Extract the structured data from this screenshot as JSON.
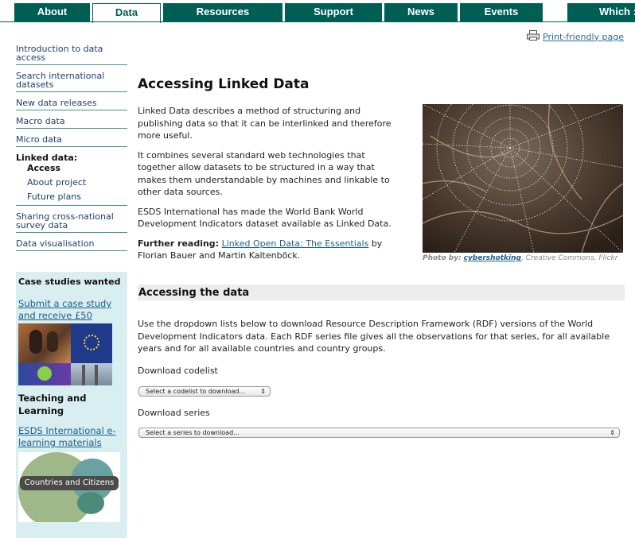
{
  "nav": {
    "tabs": [
      {
        "label": "About"
      },
      {
        "label": "Data"
      },
      {
        "label": "Resources"
      },
      {
        "label": "Support"
      },
      {
        "label": "News"
      },
      {
        "label": "Events"
      },
      {
        "label": "Which :"
      }
    ],
    "active": "Data"
  },
  "print_link": "Print-friendly page",
  "leftnav": {
    "items": [
      "Introduction to data access",
      "Search international datasets",
      "New data releases",
      "Macro data",
      "Micro data"
    ],
    "linked_heading": "Linked data:",
    "linked_sub": [
      "Access",
      "About project",
      "Future plans"
    ],
    "items_after": [
      "Sharing cross-national survey data",
      "Data visualisation"
    ]
  },
  "sidebox": {
    "heading": "Case studies wanted",
    "case_link": "Submit a case study and receive £50",
    "teaching_heading": "Teaching and Learning",
    "elearning_link": "ESDS International e-learning materials",
    "cc_label": "Countries and Citizens"
  },
  "main": {
    "title": "Accessing Linked Data",
    "para1": "Linked Data describes a method of structuring and publishing data so that it can be interlinked and therefore more useful.",
    "para2": "It combines several standard web technologies that together allow datasets to be structured in a way that makes them understandable by machines and linkable to other data sources.",
    "para3": "ESDS International has made the World Bank World Development Indicators dataset available as Linked Data.",
    "further_label": "Further reading:",
    "further_link": "Linked Open Data: The Essentials",
    "further_rest": "by Florian Bauer and Martin Kaltenböck.",
    "caption_prefix": "Photo by:",
    "caption_author": "cybershotking",
    "caption_suffix": ", Creative Commons, Flickr",
    "section_heading": "Accessing the data",
    "section_para": "Use the dropdown lists below to download Resource Description Framework (RDF) versions of the World Development Indicators data. Each RDF series file gives all the observations for that series, for all available years and for all available countries and country groups.",
    "codelist_label": "Download codelist",
    "codelist_select": "Select a codelist to download...",
    "series_label": "Download series",
    "series_select": "Select a series to download..."
  }
}
